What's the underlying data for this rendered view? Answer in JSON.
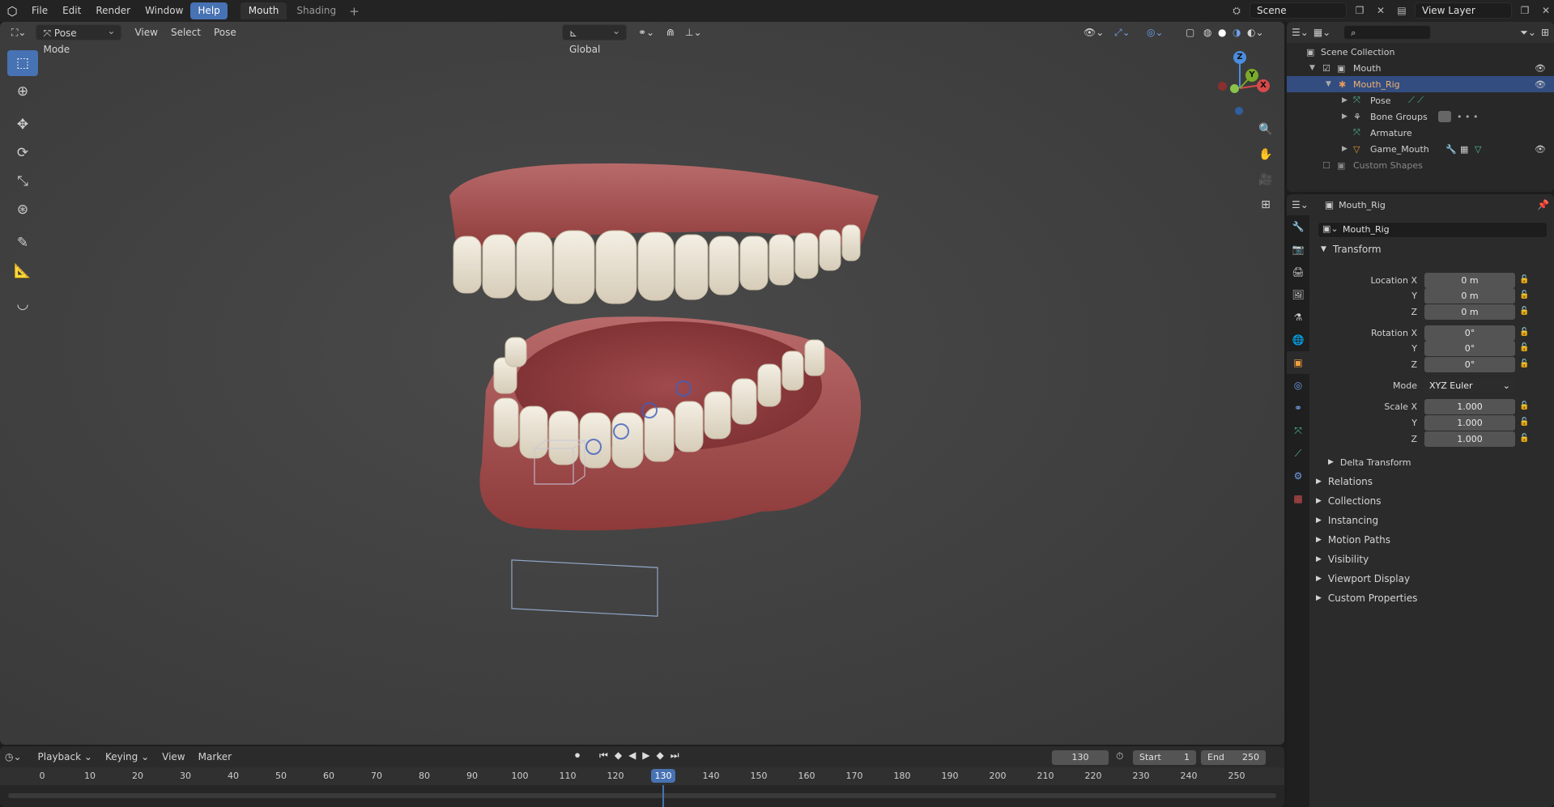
{
  "app": {
    "name": "Blender"
  },
  "topbar": {
    "menus": [
      "File",
      "Edit",
      "Render",
      "Window",
      "Help"
    ],
    "active_menu": "Help",
    "workspaces": [
      "Mouth",
      "Shading"
    ],
    "active_workspace": "Mouth",
    "add_workspace": "+",
    "scene_name": "Scene",
    "view_layer": "View Layer"
  },
  "viewport": {
    "mode": "Pose Mode",
    "menus": [
      "View",
      "Select",
      "Pose"
    ],
    "transform_orientation": "Global",
    "gizmo_axes": {
      "x": "X",
      "y": "Y",
      "z": "Z"
    }
  },
  "tools": [
    "select-box-icon",
    "cursor-icon",
    "move-icon",
    "rotate-icon",
    "scale-icon",
    "transform-icon",
    "annotate-icon",
    "measure-icon",
    "pose-relax-icon"
  ],
  "outliner": {
    "search_placeholder": "",
    "rows": [
      {
        "label": "Scene Collection",
        "icon": "collection-icon"
      },
      {
        "label": "Mouth",
        "icon": "collection-icon"
      },
      {
        "label": "Mouth_Rig",
        "icon": "armature-object-icon",
        "selected": true
      },
      {
        "label": "Pose",
        "icon": "pose-icon"
      },
      {
        "label": "Bone Groups",
        "icon": "bone-groups-icon"
      },
      {
        "label": "Armature",
        "icon": "armature-data-icon"
      },
      {
        "label": "Game_Mouth",
        "icon": "mesh-object-icon"
      },
      {
        "label": "Custom Shapes",
        "icon": "collection-icon"
      }
    ]
  },
  "properties": {
    "object_name_header": "Mouth_Rig",
    "object_name_field": "Mouth_Rig",
    "transform_label": "Transform",
    "location": {
      "label": "Location X",
      "x": "0 m",
      "y": "0 m",
      "z": "0 m"
    },
    "rotation": {
      "label": "Rotation X",
      "x": "0°",
      "y": "0°",
      "z": "0°"
    },
    "mode": {
      "label": "Mode",
      "value": "XYZ Euler"
    },
    "scale": {
      "label": "Scale X",
      "x": "1.000",
      "y": "1.000",
      "z": "1.000"
    },
    "axis_y": "Y",
    "axis_z": "Z",
    "delta_transform": "Delta Transform",
    "sections": [
      "Relations",
      "Collections",
      "Instancing",
      "Motion Paths",
      "Visibility",
      "Viewport Display",
      "Custom Properties"
    ]
  },
  "timeline": {
    "menus": [
      "Playback",
      "Keying",
      "View",
      "Marker"
    ],
    "current_frame": "130",
    "start_label": "Start",
    "start": "1",
    "end_label": "End",
    "end": "250",
    "ticks": [
      "0",
      "10",
      "20",
      "30",
      "40",
      "50",
      "60",
      "70",
      "80",
      "90",
      "100",
      "110",
      "120",
      "130",
      "140",
      "150",
      "160",
      "170",
      "180",
      "190",
      "200",
      "210",
      "220",
      "230",
      "240",
      "250"
    ]
  }
}
